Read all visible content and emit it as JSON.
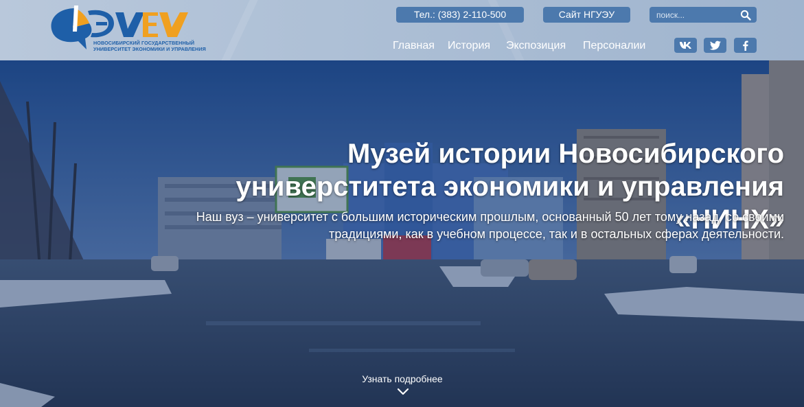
{
  "logo": {
    "letters": "НГУЭУ",
    "text_line1": "Новосибирский государственный",
    "text_line2": "университет экономики и управления"
  },
  "header": {
    "phone": "Тел.: (383) 2-110-500",
    "site_link": "Сайт НГУЭУ",
    "search_placeholder": "поиск...",
    "nav": [
      "Главная",
      "История",
      "Экспозиция",
      "Персоналии"
    ],
    "social": [
      "vk-icon",
      "twitter-icon",
      "facebook-icon"
    ]
  },
  "hero": {
    "title": "Музей истории Новосибирского универститета экономики и управления «НИНХ»",
    "subtitle": "Наш вуз – университет с большим историческим прошлым, основанный 50 лет тому назад, со своими традициями, как в учебном процессе, так и в остальных сферах деятельности.",
    "more": "Узнать подробнее"
  },
  "colors": {
    "header_bg": "#aec0d6",
    "pill_bg": "#4c79ad",
    "logo_blue": "#1e5fa8",
    "logo_orange": "#f0a020",
    "overlay": "#1c3863"
  }
}
